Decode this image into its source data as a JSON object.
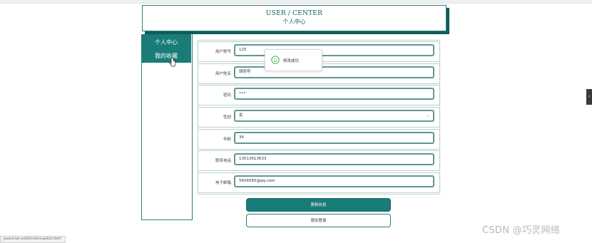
{
  "header": {
    "title": "USER / CENTER",
    "subtitle": "个人中心"
  },
  "sidebar": {
    "items": [
      {
        "label": "个人中心"
      },
      {
        "label": "我的收藏"
      }
    ]
  },
  "form": {
    "fields": [
      {
        "label": "用户账号",
        "value": "125"
      },
      {
        "label": "用户姓名",
        "value": "胡莉号"
      },
      {
        "label": "密码",
        "value": "•••"
      },
      {
        "label": "性别",
        "value": "女"
      },
      {
        "label": "年龄",
        "value": "36"
      },
      {
        "label": "联系电话",
        "value": "13513613633"
      },
      {
        "label": "电子邮箱",
        "value": "5656565@qq.com"
      }
    ]
  },
  "toast": {
    "text": "修改成功",
    "icon": "smile-icon"
  },
  "buttons": {
    "update": "更新信息",
    "logout": "退出登录"
  },
  "side_handle": {
    "glyph": "‹"
  },
  "status_url": "javascript:void(0);/storeup/list.html?",
  "watermark": "CSDN @巧灵网络",
  "colors": {
    "accent": "#1a7c78",
    "border": "#5f9794"
  }
}
